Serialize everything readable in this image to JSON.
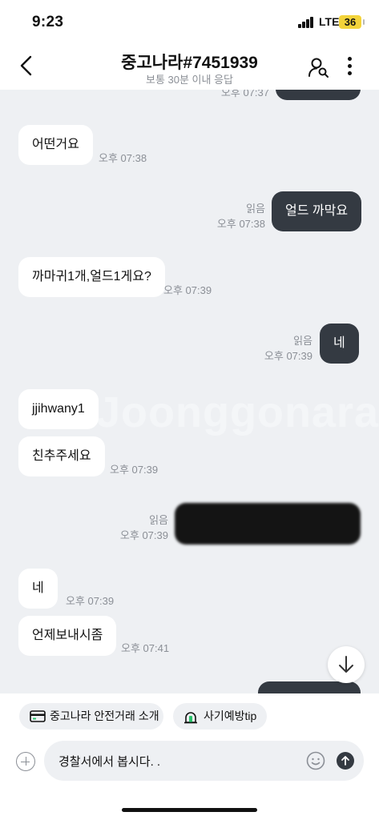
{
  "status_bar": {
    "time": "9:23",
    "network": "LTE",
    "battery": "36"
  },
  "header": {
    "title": "중고나라#7451939",
    "subtitle": "보통 30분 이내 응답"
  },
  "chat": {
    "watermark": "Joonggonara",
    "top_partial": {
      "time": "오후 07:37"
    },
    "messages": [
      {
        "text": "어떤거요",
        "time": "오후 07:38"
      },
      {
        "text": "얼드 까막요",
        "read": "읽음",
        "time": "오후 07:38"
      },
      {
        "text": "까마귀1개,얼드1게요?",
        "time": "오후 07:39"
      },
      {
        "text": "네",
        "read": "읽음",
        "time": "오후 07:39"
      },
      {
        "text": "jjihwany1"
      },
      {
        "text": "친추주세요",
        "time": "오후 07:39"
      },
      {
        "redacted": true,
        "read": "읽음",
        "time": "오후 07:39"
      },
      {
        "text": "네",
        "time": "오후 07:39"
      },
      {
        "text": "언제보내시좀",
        "time": "오후 07:41"
      }
    ]
  },
  "tips": {
    "chip1": "중고나라 안전거래 소개",
    "chip2": "사기예방tip"
  },
  "composer": {
    "value": "경찰서에서 봅시다. ."
  },
  "colors": {
    "chat_bg": "#eef0f3",
    "outgoing": "#343a42",
    "incoming": "#ffffff",
    "battery": "#f3d33a"
  }
}
